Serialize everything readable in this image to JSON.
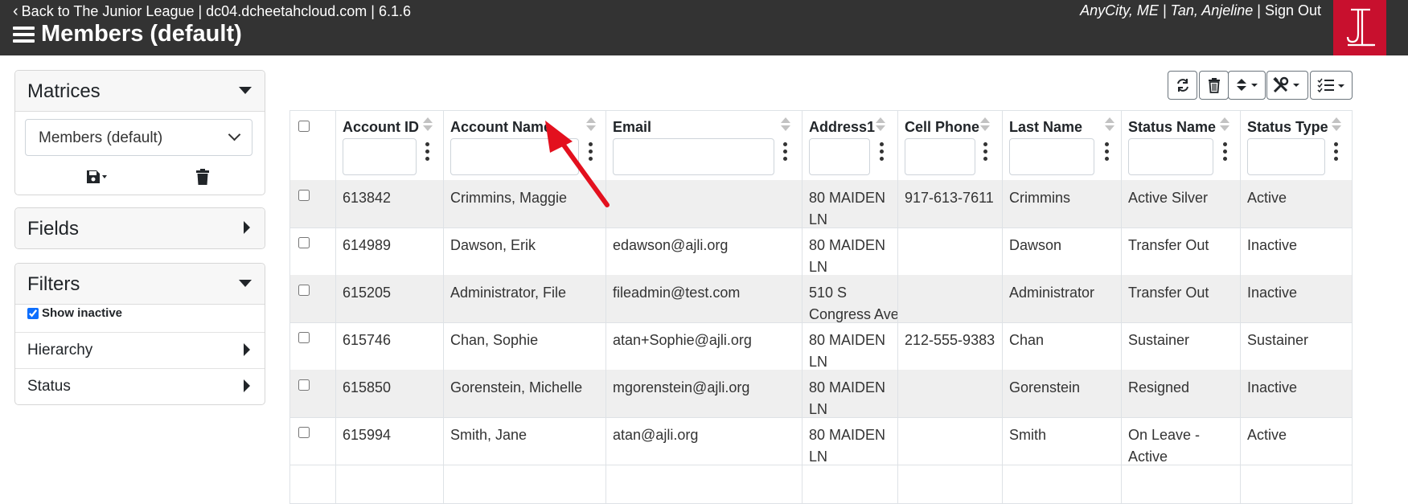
{
  "topbar": {
    "back_link": "Back to The Junior League | dc04.dcheetahcloud.com | 6.1.6",
    "page_title": "Members (default)",
    "location_user": "AnyCity, ME | Tan, Anjeline",
    "separator": " | ",
    "sign_out": "Sign Out"
  },
  "matrices": {
    "title": "Matrices",
    "selected": "Members (default)"
  },
  "fields": {
    "title": "Fields"
  },
  "filters": {
    "title": "Filters",
    "show_inactive_label": "Show inactive",
    "show_inactive_checked": true,
    "items": [
      {
        "label": "Hierarchy"
      },
      {
        "label": "Status"
      }
    ]
  },
  "toolbar": {
    "icons": [
      "refresh-icon",
      "trash-icon",
      "sort-icon",
      "tools-icon",
      "checklist-icon"
    ]
  },
  "table": {
    "columns": [
      "Account ID",
      "Account Name",
      "Email",
      "Address1",
      "Cell Phone",
      "Last Name",
      "Status Name",
      "Status Type"
    ],
    "rows": [
      [
        "613842",
        "Crimmins, Maggie",
        "",
        "80 MAIDEN|LN",
        "917-613-7611",
        "Crimmins",
        "Active Silver",
        "Active"
      ],
      [
        "614989",
        "Dawson, Erik",
        "edawson@ajli.org",
        "80 MAIDEN|LN",
        "",
        "Dawson",
        "Transfer Out",
        "Inactive"
      ],
      [
        "615205",
        "Administrator, File",
        "fileadmin@test.com",
        "510 S|Congress Ave",
        "",
        "Administrator",
        "Transfer Out",
        "Inactive"
      ],
      [
        "615746",
        "Chan, Sophie",
        "atan+Sophie@ajli.org",
        "80 MAIDEN|LN",
        "212-555-9383",
        "Chan",
        "Sustainer",
        "Sustainer"
      ],
      [
        "615850",
        "Gorenstein, Michelle",
        "mgorenstein@ajli.org",
        "80 MAIDEN|LN",
        "",
        "Gorenstein",
        "Resigned",
        "Inactive"
      ],
      [
        "615994",
        "Smith, Jane",
        "atan@ajli.org",
        "80 MAIDEN|LN",
        "",
        "Smith",
        "On Leave -|Active",
        "Active"
      ]
    ]
  },
  "colors": {
    "topbar": "#333333",
    "logo": "#c8102e",
    "row_stripe": "#efefef",
    "annotation_arrow": "#e3101e"
  }
}
